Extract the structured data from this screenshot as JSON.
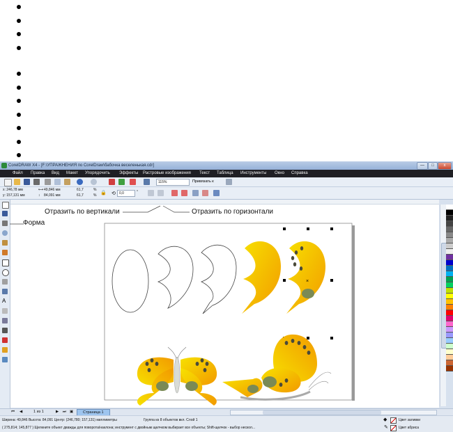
{
  "window": {
    "title": "CorelDRAW X4 - [F:\\УПРАЖНЕНИЯ по CorelDraw\\бабочка веселенькая.cdr]",
    "min_label": "—",
    "max_label": "□",
    "close_label": "x"
  },
  "menu": [
    "Файл",
    "Правка",
    "Вид",
    "Макет",
    "Упорядочить",
    "Эффекты",
    "Растровые изображения",
    "Текст",
    "Таблица",
    "Инструменты",
    "Окно",
    "Справка"
  ],
  "standard_bar": {
    "zoom": "115%",
    "snap_label": "Привязать к"
  },
  "property_bar": {
    "x": "x: 246,78 мм",
    "y": "y: 157,131 мм",
    "width": "49,846 мм",
    "height": "84,091 мм",
    "scale_x": "61,7",
    "scale_y": "61,7",
    "pct": "%",
    "angle": "0,0",
    "deg": "°"
  },
  "annotations": {
    "mirror_vertical": "Отразить по вертикали",
    "mirror_horizontal": "Отразить по горизонтали",
    "shape_tool": "Форма"
  },
  "page_nav": {
    "counter": "1 из 1",
    "tab": "Страница 1"
  },
  "status": {
    "line1": "Ширина: 49,846 Высота: 84,091 Центр: (246,780; 157,131) миллиметры",
    "group": "Группа из 8 объектов вкл. Слой 1",
    "line2": "( 275,814; 145,877 )    Щелкните объект дважды для поворота/наклона; инструмент с двойным щелчком выбирает все объекты; Shift-щелчок - выбор нескол...",
    "fill_label": "Цвет заливки",
    "outline_label": "Цвет абриса"
  },
  "colors": {
    "butterfly_orange": "#f29a00",
    "butterfly_yellow": "#f7e000",
    "spots": "#4a4a3a",
    "wing_green": "#7a8a55"
  }
}
